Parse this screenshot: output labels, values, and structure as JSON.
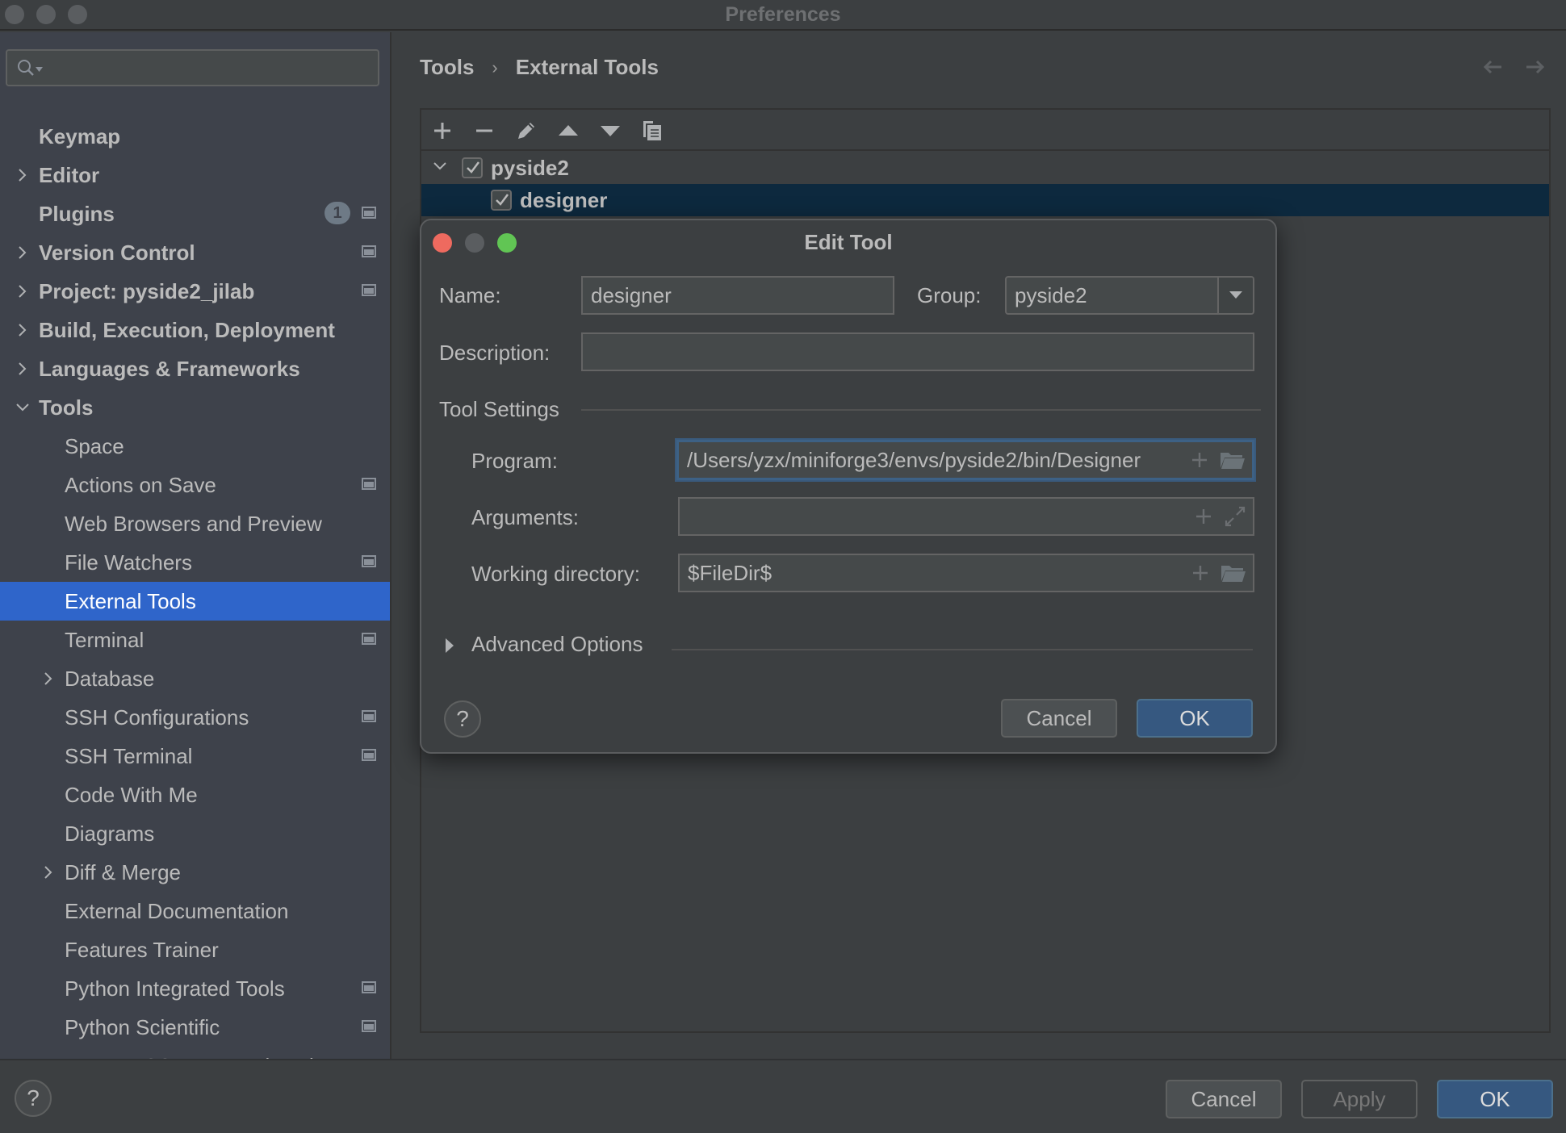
{
  "window": {
    "title": "Preferences"
  },
  "search": {
    "placeholder": "",
    "value": ""
  },
  "sidebar": {
    "items": [
      {
        "label": "Keymap",
        "level": 0,
        "expander": "none",
        "project_icon": false
      },
      {
        "label": "Editor",
        "level": 0,
        "expander": "collapsed",
        "project_icon": false
      },
      {
        "label": "Plugins",
        "level": 0,
        "expander": "none",
        "badge": "1",
        "project_icon": true
      },
      {
        "label": "Version Control",
        "level": 0,
        "expander": "collapsed",
        "project_icon": true
      },
      {
        "label": "Project: pyside2_jilab",
        "level": 0,
        "expander": "collapsed",
        "project_icon": true
      },
      {
        "label": "Build, Execution, Deployment",
        "level": 0,
        "expander": "collapsed",
        "project_icon": false
      },
      {
        "label": "Languages & Frameworks",
        "level": 0,
        "expander": "collapsed",
        "project_icon": false
      },
      {
        "label": "Tools",
        "level": 0,
        "expander": "expanded",
        "project_icon": false
      },
      {
        "label": "Space",
        "level": 1,
        "expander": "none",
        "project_icon": false
      },
      {
        "label": "Actions on Save",
        "level": 1,
        "expander": "none",
        "project_icon": true
      },
      {
        "label": "Web Browsers and Preview",
        "level": 1,
        "expander": "none",
        "project_icon": false
      },
      {
        "label": "File Watchers",
        "level": 1,
        "expander": "none",
        "project_icon": true
      },
      {
        "label": "External Tools",
        "level": 1,
        "expander": "none",
        "project_icon": false,
        "selected": true
      },
      {
        "label": "Terminal",
        "level": 1,
        "expander": "none",
        "project_icon": true
      },
      {
        "label": "Database",
        "level": 1,
        "expander": "collapsed",
        "project_icon": false
      },
      {
        "label": "SSH Configurations",
        "level": 1,
        "expander": "none",
        "project_icon": true
      },
      {
        "label": "SSH Terminal",
        "level": 1,
        "expander": "none",
        "project_icon": true
      },
      {
        "label": "Code With Me",
        "level": 1,
        "expander": "none",
        "project_icon": false
      },
      {
        "label": "Diagrams",
        "level": 1,
        "expander": "none",
        "project_icon": false
      },
      {
        "label": "Diff & Merge",
        "level": 1,
        "expander": "collapsed",
        "project_icon": false
      },
      {
        "label": "External Documentation",
        "level": 1,
        "expander": "none",
        "project_icon": false
      },
      {
        "label": "Features Trainer",
        "level": 1,
        "expander": "none",
        "project_icon": false
      },
      {
        "label": "Python Integrated Tools",
        "level": 1,
        "expander": "none",
        "project_icon": true
      },
      {
        "label": "Python Scientific",
        "level": 1,
        "expander": "none",
        "project_icon": true
      },
      {
        "label": "Remote SSH External Tools",
        "level": 1,
        "expander": "none",
        "project_icon": false
      }
    ]
  },
  "breadcrumb": {
    "parent": "Tools",
    "separator": "›",
    "current": "External Tools"
  },
  "toolbar": {
    "buttons": [
      "add-icon",
      "remove-icon",
      "edit-icon",
      "move-up-icon",
      "move-down-icon",
      "copy-icon"
    ]
  },
  "tree": {
    "group": {
      "label": "pyside2",
      "checked": true,
      "expanded": true
    },
    "items": [
      {
        "label": "designer",
        "checked": true,
        "selected": true
      }
    ]
  },
  "dialog": {
    "title": "Edit Tool",
    "name_label": "Name:",
    "name_value": "designer",
    "group_label": "Group:",
    "group_value": "pyside2",
    "description_label": "Description:",
    "description_value": "",
    "tool_settings_label": "Tool Settings",
    "program_label": "Program:",
    "program_value": "/Users/yzx/miniforge3/envs/pyside2/bin/Designer",
    "arguments_label": "Arguments:",
    "arguments_value": "",
    "working_dir_label": "Working directory:",
    "working_dir_value": "$FileDir$",
    "advanced_label": "Advanced Options",
    "help_label": "?",
    "cancel_label": "Cancel",
    "ok_label": "OK"
  },
  "footer": {
    "help_label": "?",
    "cancel_label": "Cancel",
    "apply_label": "Apply",
    "ok_label": "OK"
  },
  "colors": {
    "selection": "#2f65ca",
    "tree_selection": "#0d293e",
    "primary_button": "#365880",
    "close": "#ee6a5f",
    "minimize": "#5a5d60",
    "maximize": "#61c554"
  }
}
